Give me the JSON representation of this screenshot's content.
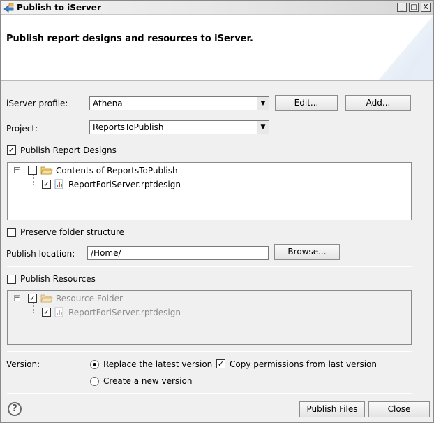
{
  "window": {
    "title": "Publish to iServer",
    "controls": {
      "minimize": "_",
      "maximize": "□",
      "close": "X"
    }
  },
  "header": {
    "text": "Publish report designs and resources to iServer."
  },
  "profile": {
    "label": "iServer profile:",
    "value": "Athena",
    "edit_label": "Edit...",
    "add_label": "Add..."
  },
  "project": {
    "label": "Project:",
    "value": "ReportsToPublish"
  },
  "report_designs": {
    "checkbox_label": "Publish Report Designs",
    "checked": true,
    "tree": {
      "root": "Contents of ReportsToPublish",
      "child": "ReportForiServer.rptdesign"
    }
  },
  "preserve": {
    "label": "Preserve folder structure",
    "checked": false
  },
  "location": {
    "label": "Publish location:",
    "value": "/Home/",
    "browse_label": "Browse..."
  },
  "resources": {
    "checkbox_label": "Publish Resources",
    "checked": false,
    "tree": {
      "root": "Resource Folder",
      "child": "ReportForiServer.rptdesign"
    }
  },
  "version": {
    "label": "Version:",
    "replace_label": "Replace the latest version",
    "create_label": "Create a new version",
    "selected": "replace",
    "copy_permissions_label": "Copy permissions from last version",
    "copy_permissions_checked": true
  },
  "footer": {
    "help": "?",
    "publish_label": "Publish Files",
    "close_label": "Close"
  },
  "colors": {
    "folder": "#e8b84a",
    "accent": "#4a7fc0"
  }
}
